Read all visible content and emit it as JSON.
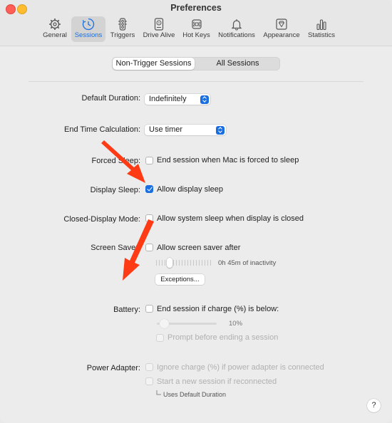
{
  "window": {
    "title": "Preferences"
  },
  "toolbar": {
    "items": [
      {
        "label": "General",
        "icon": "gear-icon"
      },
      {
        "label": "Sessions",
        "icon": "clock-icon",
        "active": true
      },
      {
        "label": "Triggers",
        "icon": "traffic-light-icon"
      },
      {
        "label": "Drive Alive",
        "icon": "drive-icon"
      },
      {
        "label": "Hot Keys",
        "icon": "keyboard-icon"
      },
      {
        "label": "Notifications",
        "icon": "bell-icon"
      },
      {
        "label": "Appearance",
        "icon": "diamond-frame-icon"
      },
      {
        "label": "Statistics",
        "icon": "bar-chart-icon"
      }
    ]
  },
  "tabs": {
    "non_trigger": "Non-Trigger Sessions",
    "all": "All Sessions",
    "selected": "Non-Trigger Sessions"
  },
  "form": {
    "default_duration": {
      "label": "Default Duration:",
      "value": "Indefinitely"
    },
    "end_time_calc": {
      "label": "End Time Calculation:",
      "value": "Use timer"
    },
    "forced_sleep": {
      "label": "Forced Sleep:",
      "option": "End session when Mac is forced to sleep",
      "checked": false
    },
    "display_sleep": {
      "label": "Display Sleep:",
      "option": "Allow display sleep",
      "checked": true
    },
    "closed_display": {
      "label": "Closed-Display Mode:",
      "option": "Allow system sleep when display is closed",
      "checked": false
    },
    "screen_saver": {
      "label": "Screen Saver:",
      "option": "Allow screen saver after",
      "checked": false,
      "inactivity_text": "0h 45m of inactivity",
      "exceptions_button": "Exceptions..."
    },
    "battery": {
      "label": "Battery:",
      "option": "End session if charge (%) is below:",
      "checked": false,
      "percent_text": "10%",
      "prompt_option": "Prompt before ending a session"
    },
    "power_adapter": {
      "label": "Power Adapter:",
      "ignore_option": "Ignore charge (%) if power adapter is connected",
      "start_option": "Start a new session if reconnected",
      "note": "Uses Default Duration"
    }
  },
  "help_button": "?",
  "colors": {
    "accent": "#1a6fe0",
    "annotation_arrow": "#ff3b16"
  }
}
